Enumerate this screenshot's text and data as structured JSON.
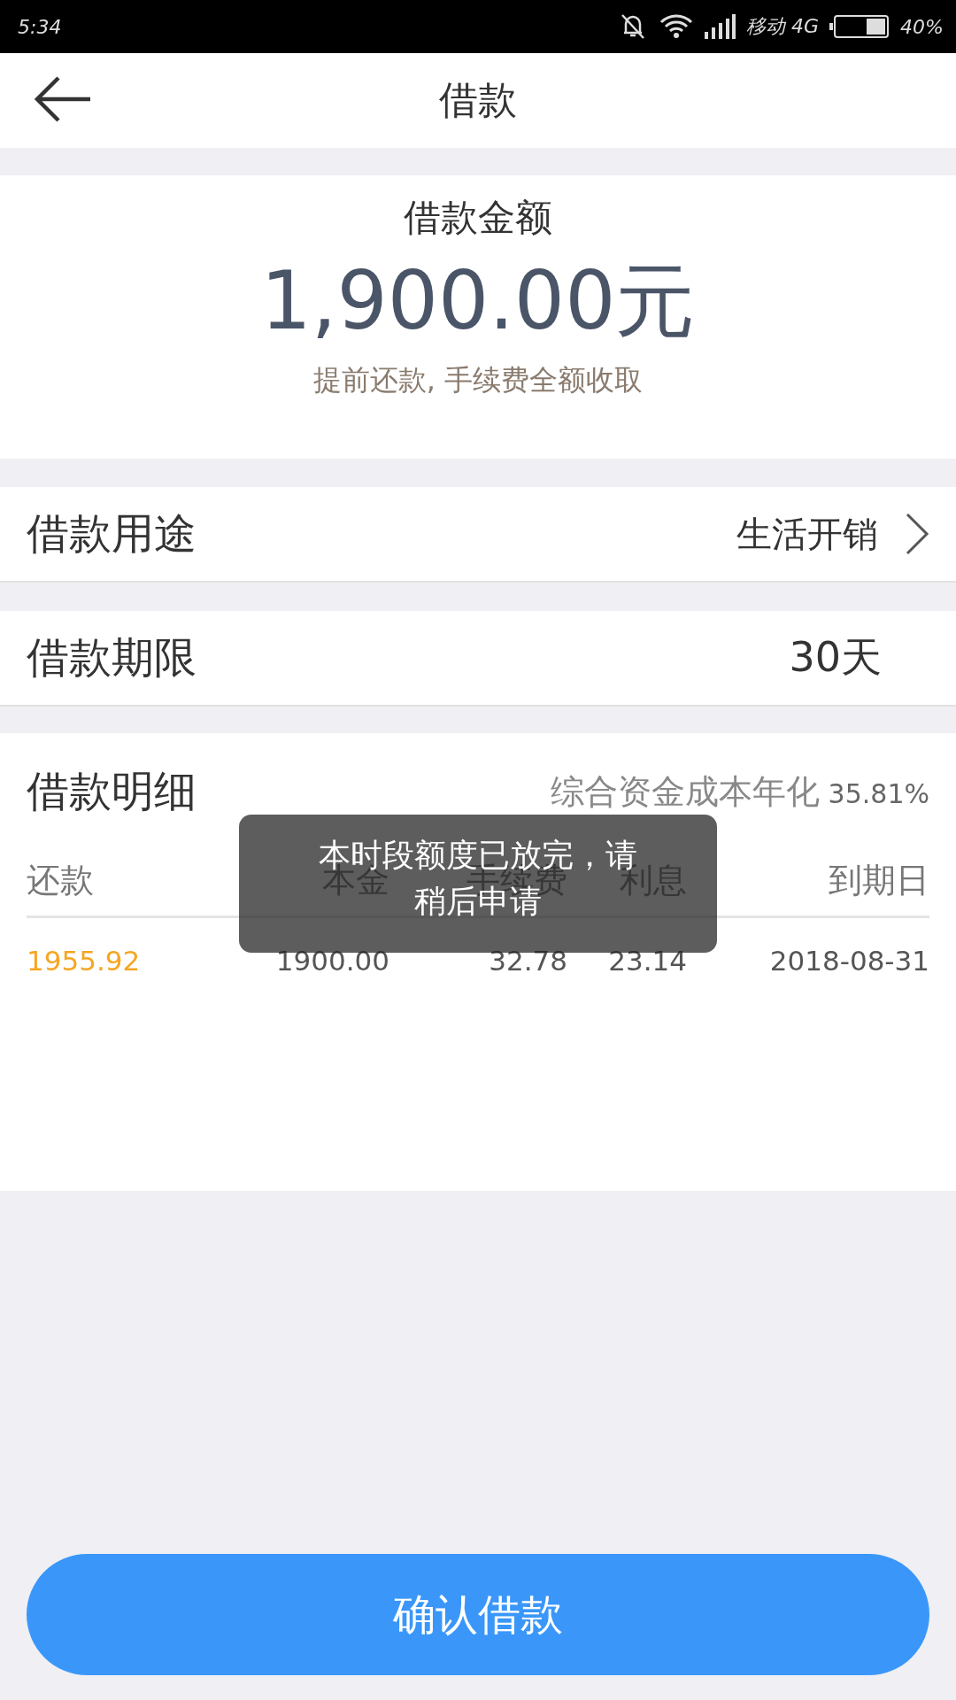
{
  "status_bar": {
    "time": "5:34",
    "carrier": "移动 4G",
    "battery": "40%"
  },
  "header": {
    "title": "借款"
  },
  "amount": {
    "label": "借款金额",
    "value": "1,900.00元",
    "note": "提前还款, 手续费全额收取"
  },
  "rows": [
    {
      "label": "借款用途",
      "value": "生活开销",
      "kind": "select"
    },
    {
      "label": "借款期限",
      "value": "30天",
      "kind": "static"
    }
  ],
  "details": {
    "title": "借款明细",
    "rate_label": "综合资金成本年化",
    "rate": "35.81%",
    "columns": [
      "还款",
      "本金",
      "手续费",
      "利息",
      "到期日"
    ],
    "rows": [
      [
        "1955.92",
        "1900.00",
        "32.78",
        "23.14",
        "2018-08-31"
      ]
    ]
  },
  "toast": {
    "message": "本时段额度已放完，请稍后申请"
  },
  "confirm_button": "确认借款"
}
